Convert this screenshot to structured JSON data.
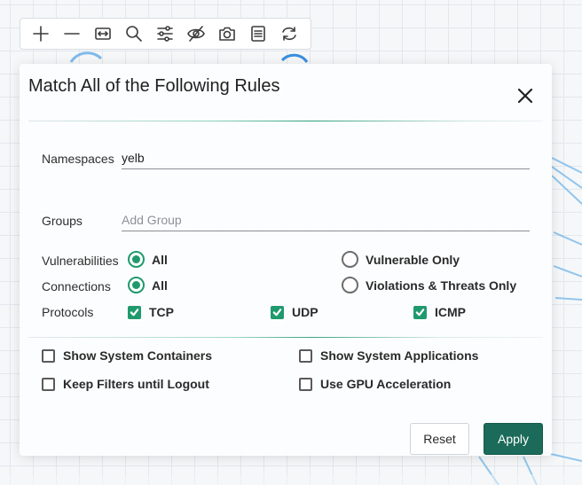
{
  "toolbar": {
    "tools": [
      {
        "icon": "zoom-in-icon",
        "name": "zoom-in-button"
      },
      {
        "icon": "zoom-out-icon",
        "name": "zoom-out-button"
      },
      {
        "icon": "fit-to-screen-icon",
        "name": "fit-to-screen-button"
      },
      {
        "icon": "search-icon",
        "name": "search-button"
      },
      {
        "icon": "filter-sliders-icon",
        "name": "filter-button"
      },
      {
        "icon": "eye-off-icon",
        "name": "hide-button"
      },
      {
        "icon": "camera-icon",
        "name": "snapshot-button"
      },
      {
        "icon": "list-icon",
        "name": "list-view-button"
      },
      {
        "icon": "refresh-icon",
        "name": "refresh-button"
      }
    ]
  },
  "dialog": {
    "title": "Match All of the Following Rules",
    "close_icon": "close-icon",
    "namespaces": {
      "label": "Namespaces",
      "value": "yelb",
      "placeholder": ""
    },
    "groups": {
      "label": "Groups",
      "value": "",
      "placeholder": "Add Group"
    },
    "vulnerabilities": {
      "label": "Vulnerabilities",
      "options": [
        {
          "label": "All",
          "selected": true
        },
        {
          "label": "Vulnerable Only",
          "selected": false
        }
      ]
    },
    "connections": {
      "label": "Connections",
      "options": [
        {
          "label": "All",
          "selected": true
        },
        {
          "label": "Violations & Threats Only",
          "selected": false
        }
      ]
    },
    "protocols": {
      "label": "Protocols",
      "options": [
        {
          "label": "TCP",
          "checked": true
        },
        {
          "label": "UDP",
          "checked": true
        },
        {
          "label": "ICMP",
          "checked": true
        }
      ]
    },
    "display_options": [
      {
        "label": "Show System Containers",
        "checked": false
      },
      {
        "label": "Show System Applications",
        "checked": false
      },
      {
        "label": "Keep Filters until Logout",
        "checked": false
      },
      {
        "label": "Use GPU Acceleration",
        "checked": false
      }
    ],
    "reset_label": "Reset",
    "apply_label": "Apply"
  },
  "colors": {
    "accent": "#1f9a6e",
    "apply_button": "#1c6b5a",
    "graph_lines": "#6fb3e6"
  }
}
